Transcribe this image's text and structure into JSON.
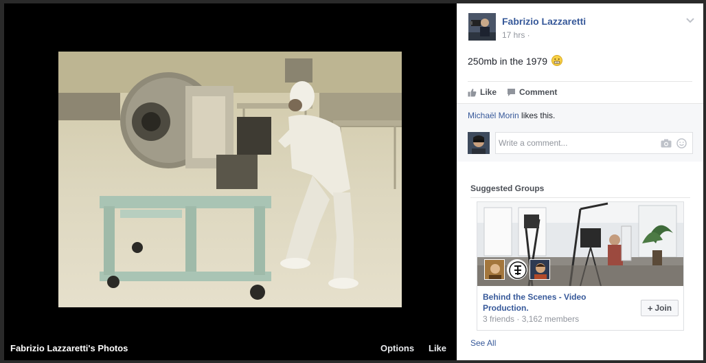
{
  "viewer": {
    "album_title": "Fabrizio Lazzaretti's Photos",
    "options_label": "Options",
    "like_label": "Like"
  },
  "post": {
    "author": "Fabrizio Lazzaretti",
    "time": "17 hrs ·",
    "text": "250mb in the 1979",
    "emoji": "grimace-emoji",
    "actions": {
      "like_label": "Like",
      "comment_label": "Comment"
    },
    "likers": {
      "name": "Michaël Morin",
      "suffix": " likes this."
    },
    "comment_placeholder": "Write a comment..."
  },
  "suggested": {
    "title": "Suggested Groups",
    "group": {
      "name": "Behind the Scenes - Video Production.",
      "meta": "3 friends · 3,162 members",
      "join_label": "Join"
    },
    "see_all_label": "See All"
  },
  "icons": {
    "chevron": "chevron-down-icon",
    "like": "thumbs-up-icon",
    "comment": "comment-bubble-icon",
    "camera": "camera-icon",
    "sticker": "smiley-icon"
  },
  "colors": {
    "link_blue": "#365899",
    "meta_gray": "#90949c",
    "background_black": "#000000"
  }
}
